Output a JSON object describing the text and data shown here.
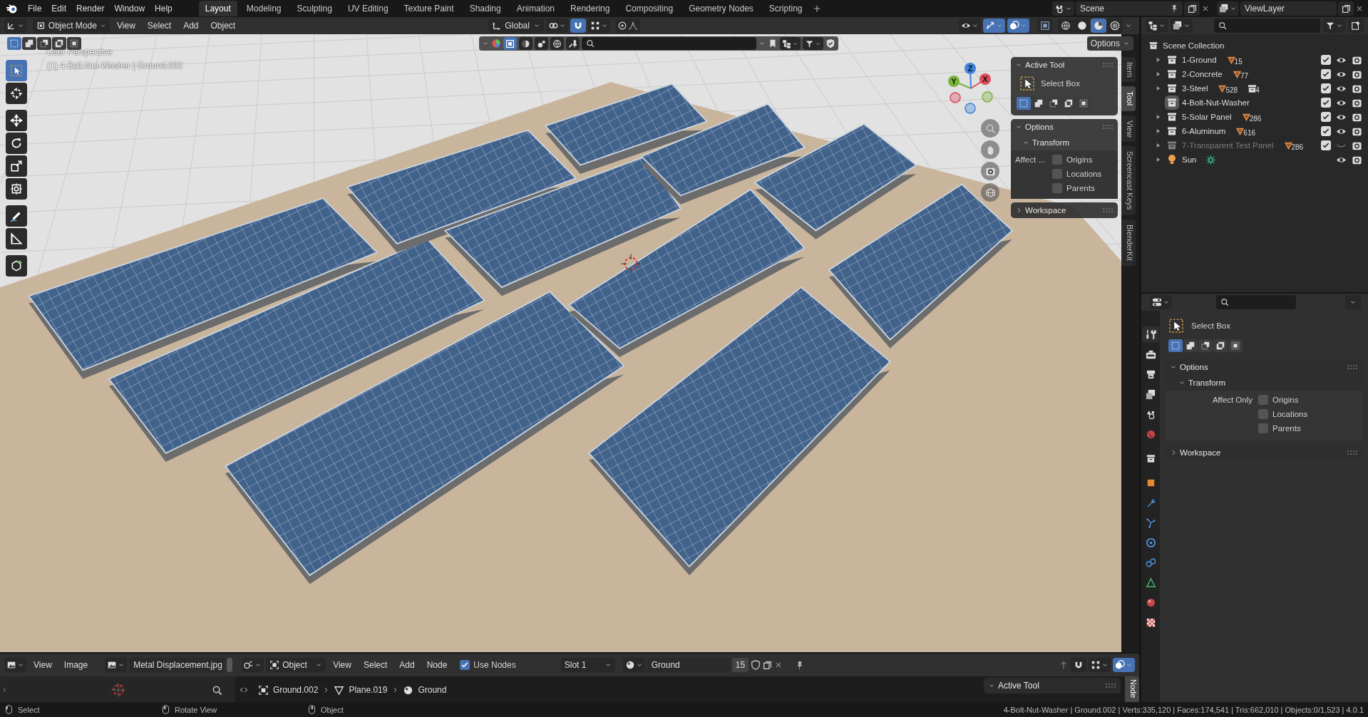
{
  "top_bar": {
    "menus": [
      "File",
      "Edit",
      "Render",
      "Window",
      "Help"
    ],
    "workspaces": [
      {
        "label": "Layout",
        "selected": true
      },
      {
        "label": "Modeling",
        "selected": false
      },
      {
        "label": "Sculpting",
        "selected": false
      },
      {
        "label": "UV Editing",
        "selected": false
      },
      {
        "label": "Texture Paint",
        "selected": false
      },
      {
        "label": "Shading",
        "selected": false
      },
      {
        "label": "Animation",
        "selected": false
      },
      {
        "label": "Rendering",
        "selected": false
      },
      {
        "label": "Compositing",
        "selected": false
      },
      {
        "label": "Geometry Nodes",
        "selected": false
      },
      {
        "label": "Scripting",
        "selected": false
      }
    ],
    "scene": "Scene",
    "view_layer": "ViewLayer"
  },
  "viewport": {
    "header": {
      "mode": "Object Mode",
      "menus": [
        "View",
        "Select",
        "Add",
        "Object"
      ],
      "orientation": "Global",
      "snap": true,
      "gizmos": true,
      "overlays": true,
      "xray": false,
      "shading": [
        {
          "kind": "wireframe",
          "selected": false
        },
        {
          "kind": "solid",
          "selected": false
        },
        {
          "kind": "material",
          "selected": true
        },
        {
          "kind": "rendered",
          "selected": false
        }
      ]
    },
    "select_modes": [
      {
        "kind": "set",
        "selected": true
      },
      {
        "kind": "extend",
        "selected": false
      },
      {
        "kind": "subtract",
        "selected": false
      },
      {
        "kind": "invert",
        "selected": false
      },
      {
        "kind": "intersect",
        "selected": false
      }
    ],
    "options_button": "Options",
    "overlay_text": [
      "User Perspective",
      "(1) 4-Bolt-Nut-Washer | Ground.002"
    ],
    "tools": [
      {
        "kind": "select-box",
        "selected": true
      },
      {
        "kind": "cursor",
        "selected": false
      },
      {
        "kind": "move",
        "selected": false
      },
      {
        "kind": "rotate",
        "selected": false
      },
      {
        "kind": "scale",
        "selected": false
      },
      {
        "kind": "transform",
        "selected": false
      },
      {
        "kind": "annotate",
        "selected": false
      },
      {
        "kind": "measure",
        "selected": false
      },
      {
        "kind": "add-cube",
        "selected": false
      }
    ],
    "gizmo_axes": [
      {
        "label": "X",
        "color": "#e04a5a"
      },
      {
        "label": "Y",
        "color": "#7bb33a"
      },
      {
        "label": "Z",
        "color": "#3d83dd"
      }
    ],
    "n_panel": {
      "active_tool": {
        "title": "Active Tool",
        "tool": "Select Box",
        "modes": [
          {
            "kind": "set",
            "selected": true
          },
          {
            "kind": "extend",
            "selected": false
          },
          {
            "kind": "subtract",
            "selected": false
          },
          {
            "kind": "invert",
            "selected": false
          },
          {
            "kind": "intersect",
            "selected": false
          }
        ]
      },
      "options": {
        "title": "Options",
        "transform": "Transform",
        "affect_label": "Affect ...",
        "checks": [
          {
            "label": "Origins",
            "checked": false
          },
          {
            "label": "Locations",
            "checked": false
          },
          {
            "label": "Parents",
            "checked": false
          }
        ]
      },
      "workspace": "Workspace"
    },
    "side_tabs": [
      {
        "label": "Item",
        "selected": false
      },
      {
        "label": "Tool",
        "selected": true
      },
      {
        "label": "View",
        "selected": false
      },
      {
        "label": "Screencast Keys",
        "selected": false
      },
      {
        "label": "BlenderKit",
        "selected": false
      }
    ]
  },
  "outliner": {
    "root": "Scene Collection",
    "items": [
      {
        "name": "1-Ground",
        "kind": "collection",
        "expandable": true,
        "active": false,
        "disabled": false,
        "badges": [
          {
            "kind": "mesh",
            "count": "15"
          }
        ],
        "checked": true,
        "visible": true
      },
      {
        "name": "2-Concrete",
        "kind": "collection",
        "expandable": true,
        "active": false,
        "disabled": false,
        "badges": [
          {
            "kind": "mesh",
            "count": "77"
          }
        ],
        "checked": true,
        "visible": true
      },
      {
        "name": "3-Steel",
        "kind": "collection",
        "expandable": true,
        "active": false,
        "disabled": false,
        "badges": [
          {
            "kind": "mesh",
            "count": "528"
          },
          {
            "kind": "collection",
            "count": "4"
          }
        ],
        "checked": true,
        "visible": true
      },
      {
        "name": "4-Bolt-Nut-Washer",
        "kind": "collection",
        "expandable": false,
        "active": true,
        "disabled": false,
        "checked": true,
        "visible": true
      },
      {
        "name": "5-Solar Panel",
        "kind": "collection",
        "expandable": true,
        "active": false,
        "disabled": false,
        "badges": [
          {
            "kind": "mesh",
            "count": "286"
          }
        ],
        "checked": true,
        "visible": true
      },
      {
        "name": "6-Aluminum",
        "kind": "collection",
        "expandable": true,
        "active": false,
        "disabled": false,
        "badges": [
          {
            "kind": "mesh",
            "count": "616"
          }
        ],
        "checked": true,
        "visible": true
      },
      {
        "name": "7-Transparent Test Panel",
        "kind": "collection",
        "expandable": true,
        "active": false,
        "disabled": true,
        "badges": [
          {
            "kind": "mesh",
            "count": "286"
          }
        ],
        "checked": true,
        "visible": false
      },
      {
        "name": "Sun",
        "kind": "light",
        "expandable": true,
        "active": false,
        "disabled": false,
        "badges": [
          {
            "kind": "sun"
          }
        ],
        "visible": true
      }
    ]
  },
  "properties": {
    "tabs": [
      {
        "kind": "tool",
        "selected": true
      },
      {
        "kind": "render",
        "selected": false
      },
      {
        "kind": "output",
        "selected": false
      },
      {
        "kind": "view_layer",
        "selected": false
      },
      {
        "kind": "scene",
        "selected": false
      },
      {
        "kind": "world",
        "selected": false
      },
      {
        "kind": "collection",
        "selected": false
      },
      {
        "kind": "object",
        "selected": false
      },
      {
        "kind": "modifier",
        "selected": false
      },
      {
        "kind": "particles",
        "selected": false
      },
      {
        "kind": "physics",
        "selected": false
      },
      {
        "kind": "constraints",
        "selected": false
      },
      {
        "kind": "data",
        "selected": false
      },
      {
        "kind": "material",
        "selected": false
      },
      {
        "kind": "texture",
        "selected": false
      }
    ],
    "tool": "Select Box",
    "modes": [
      {
        "kind": "set",
        "selected": true
      },
      {
        "kind": "extend",
        "selected": false
      },
      {
        "kind": "subtract",
        "selected": false
      },
      {
        "kind": "invert",
        "selected": false
      },
      {
        "kind": "intersect",
        "selected": false
      }
    ],
    "options_title": "Options",
    "transform_title": "Transform",
    "affect_label": "Affect Only",
    "checks": [
      {
        "label": "Origins",
        "checked": false
      },
      {
        "label": "Locations",
        "checked": false
      },
      {
        "label": "Parents",
        "checked": false
      }
    ],
    "workspace": "Workspace"
  },
  "shader_editor": {
    "image_menus": [
      "View",
      "Image"
    ],
    "image": "Metal Displacement.jpg",
    "object_type": "Object",
    "menus": [
      "View",
      "Select",
      "Add",
      "Node"
    ],
    "use_nodes": {
      "label": "Use Nodes",
      "checked": true
    },
    "slot": "Slot 1",
    "material": "Ground",
    "users": "15",
    "breadcrumbs": [
      {
        "kind": "object",
        "label": "Ground.002"
      },
      {
        "kind": "mesh",
        "label": "Plane.019"
      },
      {
        "kind": "material",
        "label": "Ground"
      }
    ],
    "overlays": true,
    "sidebar_title": "Active Tool",
    "sidebar_tab": "Node"
  },
  "status_bar": {
    "hints": [
      {
        "kind": "left",
        "label": "Select"
      },
      {
        "kind": "middle",
        "label": "Rotate View"
      },
      {
        "kind": "right",
        "label": "Object"
      }
    ],
    "stats": "4-Bolt-Nut-Washer | Ground.002 | Verts:335,120 | Faces:174,541 | Tris:662,010 | Objects:0/1,523 | 4.0.1"
  }
}
